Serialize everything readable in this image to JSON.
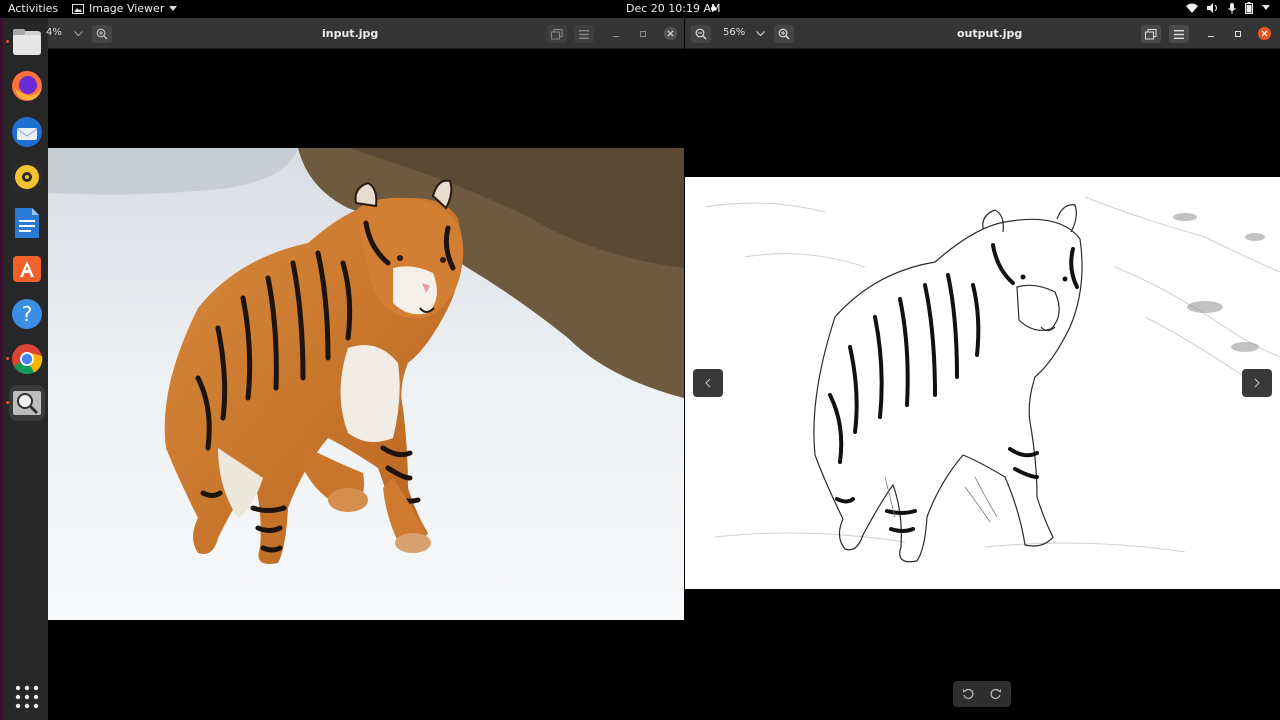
{
  "topbar": {
    "activities": "Activities",
    "app_name": "Image Viewer",
    "clock": "Dec 20  10:19 AM"
  },
  "dock": {
    "items": [
      {
        "name": "files",
        "color": "#d8d8d8"
      },
      {
        "name": "firefox",
        "color": "#ff7139"
      },
      {
        "name": "thunderbird",
        "color": "#2b7bd6"
      },
      {
        "name": "rhythmbox",
        "color": "#f2c230"
      },
      {
        "name": "libreoffice-writer",
        "color": "#1f6ed4"
      },
      {
        "name": "ubuntu-software",
        "color": "#f0602a"
      },
      {
        "name": "help",
        "color": "#3a8ee6"
      },
      {
        "name": "chrome",
        "color": "#34a853"
      },
      {
        "name": "image-viewer",
        "color": "#9a9a9a"
      }
    ]
  },
  "left_window": {
    "title": "input.jpg",
    "zoom": "4%"
  },
  "right_window": {
    "title": "output.jpg",
    "zoom": "56%"
  },
  "colors": {
    "accent": "#e95420",
    "titlebar": "#353535",
    "dock": "#272727"
  }
}
